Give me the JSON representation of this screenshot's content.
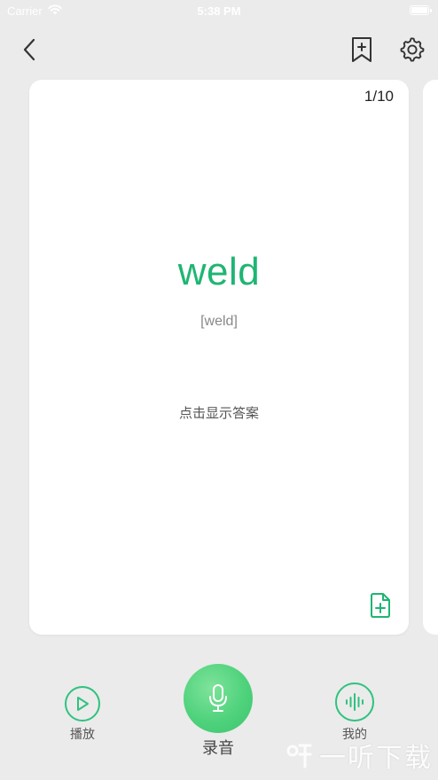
{
  "status_bar": {
    "carrier": "Carrier",
    "time": "5:38 PM"
  },
  "nav": {
    "back_icon": "chevron-left-icon",
    "bookmark_icon": "bookmark-add-icon",
    "settings_icon": "gear-icon"
  },
  "card": {
    "counter": "1/10",
    "word": "weld",
    "phonetic": "[weld]",
    "hint": "点击显示答案",
    "add_icon": "file-plus-icon"
  },
  "bottom_bar": {
    "play_label": "播放",
    "record_label": "录音",
    "mine_label": "我的"
  },
  "watermark": {
    "text": "一听下载"
  },
  "colors": {
    "accent": "#1fb573",
    "background": "#ebebeb",
    "card": "#ffffff"
  }
}
